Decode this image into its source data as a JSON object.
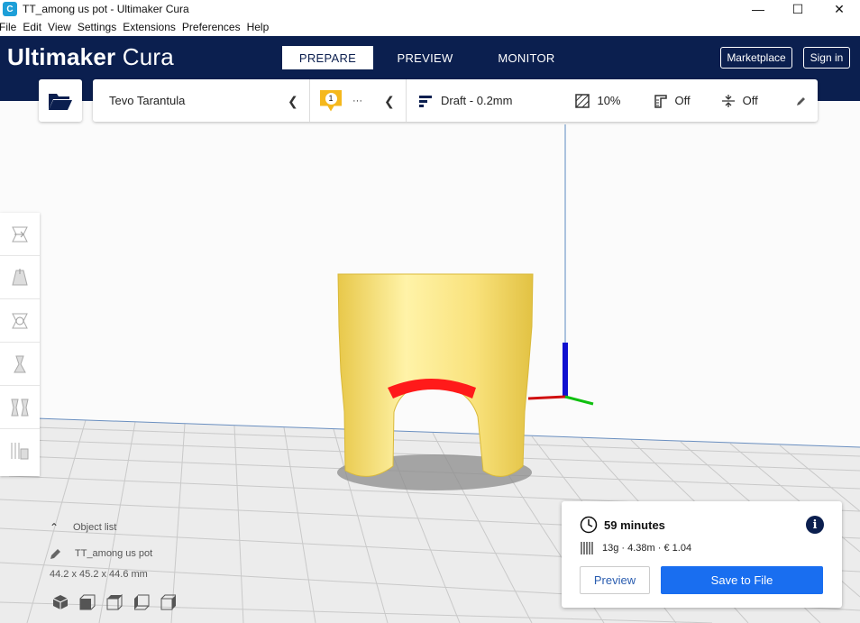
{
  "window": {
    "title": "TT_among us pot - Ultimaker Cura",
    "minimize_glyph": "—",
    "maximize_glyph": "☐",
    "close_glyph": "✕"
  },
  "menu": [
    "File",
    "Edit",
    "View",
    "Settings",
    "Extensions",
    "Preferences",
    "Help"
  ],
  "header": {
    "logo_bold": "Ultimaker",
    "logo_light": " Cura",
    "tabs": [
      "PREPARE",
      "PREVIEW",
      "MONITOR"
    ],
    "marketplace": "Marketplace",
    "signin": "Sign in"
  },
  "toolbar": {
    "printer": "Tevo Tarantula",
    "extruder_count": "1",
    "extruder_more": "···",
    "profile": "Draft - 0.2mm",
    "infill": "10%",
    "support": "Off",
    "adhesion": "Off"
  },
  "object": {
    "list_label": "Object list",
    "name": "TT_among us pot",
    "dimensions": "44.2 x 45.2 x 44.6 mm"
  },
  "print": {
    "time": "59 minutes",
    "material": "13g · 4.38m · € 1.04",
    "preview_label": "Preview",
    "save_label": "Save to File"
  },
  "colors": {
    "header_bg": "#0b1f4f",
    "accent": "#196ef0",
    "model": "#f7e27a",
    "overhang": "#ff0000"
  }
}
